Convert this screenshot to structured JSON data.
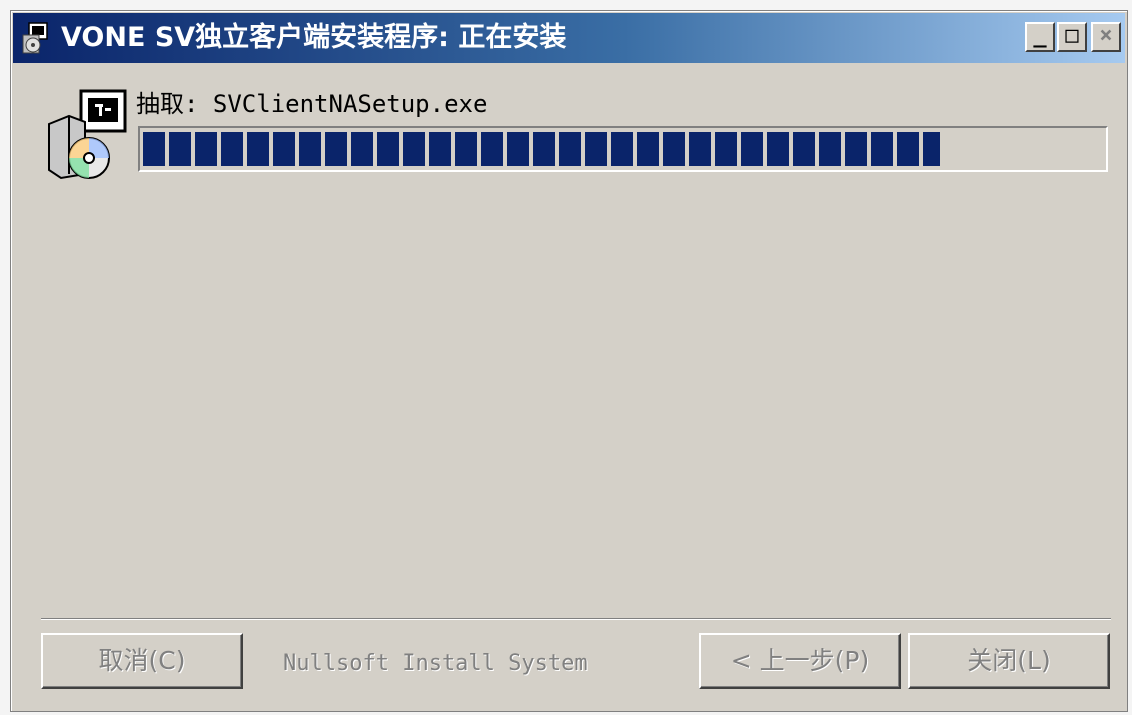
{
  "window": {
    "title": "VONE SV独立客户端安装程序: 正在安装",
    "controls": {
      "minimize": "_",
      "maximize": "□",
      "close": "×"
    }
  },
  "install": {
    "status_text": "抽取: SVClientNASetup.exe",
    "progress": 0.83
  },
  "footer": {
    "brand": "Nullsoft Install System",
    "cancel_label": "取消(C)",
    "back_label": "< 上一步(P)",
    "close_label": "关闭(L)"
  },
  "icons": {
    "title": "installer-icon",
    "status": "setup-package-icon"
  },
  "colors": {
    "title_start": "#0a246a",
    "title_end": "#a6caf0",
    "progress": "#0a246a",
    "face": "#d4d0c8"
  }
}
